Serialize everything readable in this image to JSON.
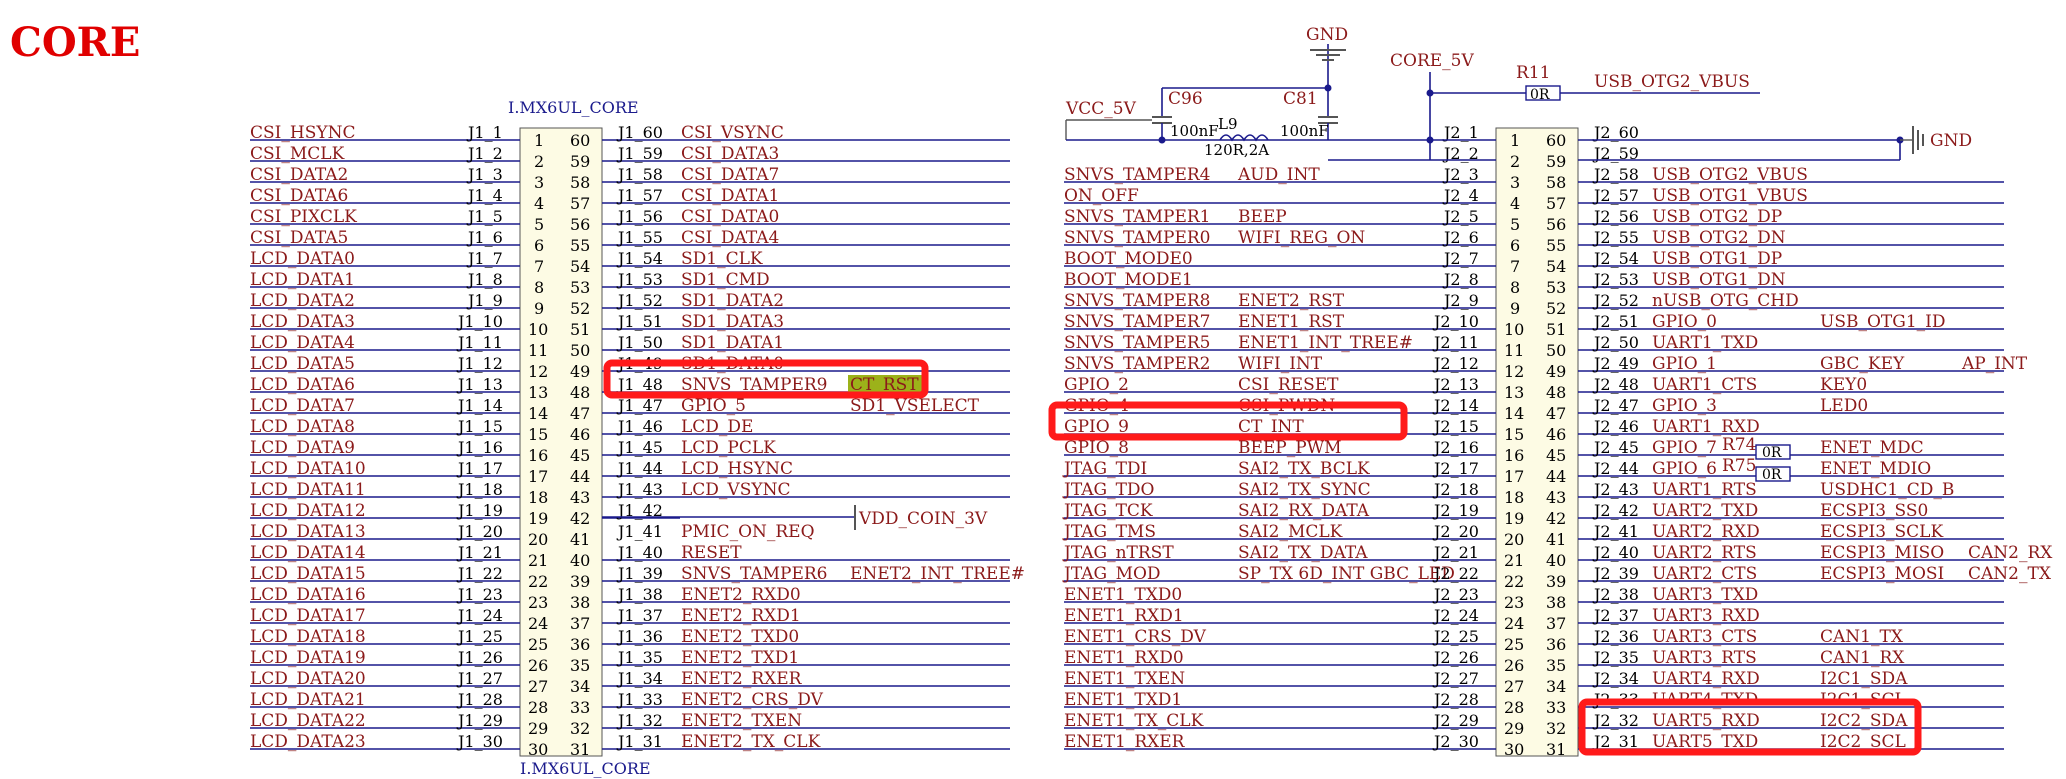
{
  "page_title": "CORE",
  "left_chip": {
    "name": "I.MX6UL_CORE",
    "left": [
      {
        "sig": "CSI_HSYNC",
        "ref": "J1_1"
      },
      {
        "sig": "CSI_MCLK",
        "ref": "J1_2"
      },
      {
        "sig": "CSI_DATA2",
        "ref": "J1_3"
      },
      {
        "sig": "CSI_DATA6",
        "ref": "J1_4"
      },
      {
        "sig": "CSI_PIXCLK",
        "ref": "J1_5"
      },
      {
        "sig": "CSI_DATA5",
        "ref": "J1_6"
      },
      {
        "sig": "LCD_DATA0",
        "ref": "J1_7"
      },
      {
        "sig": "LCD_DATA1",
        "ref": "J1_8"
      },
      {
        "sig": "LCD_DATA2",
        "ref": "J1_9"
      },
      {
        "sig": "LCD_DATA3",
        "ref": "J1_10"
      },
      {
        "sig": "LCD_DATA4",
        "ref": "J1_11"
      },
      {
        "sig": "LCD_DATA5",
        "ref": "J1_12"
      },
      {
        "sig": "LCD_DATA6",
        "ref": "J1_13"
      },
      {
        "sig": "LCD_DATA7",
        "ref": "J1_14"
      },
      {
        "sig": "LCD_DATA8",
        "ref": "J1_15"
      },
      {
        "sig": "LCD_DATA9",
        "ref": "J1_16"
      },
      {
        "sig": "LCD_DATA10",
        "ref": "J1_17"
      },
      {
        "sig": "LCD_DATA11",
        "ref": "J1_18"
      },
      {
        "sig": "LCD_DATA12",
        "ref": "J1_19"
      },
      {
        "sig": "LCD_DATA13",
        "ref": "J1_20"
      },
      {
        "sig": "LCD_DATA14",
        "ref": "J1_21"
      },
      {
        "sig": "LCD_DATA15",
        "ref": "J1_22"
      },
      {
        "sig": "LCD_DATA16",
        "ref": "J1_23"
      },
      {
        "sig": "LCD_DATA17",
        "ref": "J1_24"
      },
      {
        "sig": "LCD_DATA18",
        "ref": "J1_25"
      },
      {
        "sig": "LCD_DATA19",
        "ref": "J1_26"
      },
      {
        "sig": "LCD_DATA20",
        "ref": "J1_27"
      },
      {
        "sig": "LCD_DATA21",
        "ref": "J1_28"
      },
      {
        "sig": "LCD_DATA22",
        "ref": "J1_29"
      },
      {
        "sig": "LCD_DATA23",
        "ref": "J1_30"
      }
    ],
    "right": [
      {
        "ref": "J1_60",
        "sig": "CSI_VSYNC",
        "extra": ""
      },
      {
        "ref": "J1_59",
        "sig": "CSI_DATA3",
        "extra": ""
      },
      {
        "ref": "J1_58",
        "sig": "CSI_DATA7",
        "extra": ""
      },
      {
        "ref": "J1_57",
        "sig": "CSI_DATA1",
        "extra": ""
      },
      {
        "ref": "J1_56",
        "sig": "CSI_DATA0",
        "extra": ""
      },
      {
        "ref": "J1_55",
        "sig": "CSI_DATA4",
        "extra": ""
      },
      {
        "ref": "J1_54",
        "sig": "SD1_CLK",
        "extra": ""
      },
      {
        "ref": "J1_53",
        "sig": "SD1_CMD",
        "extra": ""
      },
      {
        "ref": "J1_52",
        "sig": "SD1_DATA2",
        "extra": ""
      },
      {
        "ref": "J1_51",
        "sig": "SD1_DATA3",
        "extra": ""
      },
      {
        "ref": "J1_50",
        "sig": "SD1_DATA1",
        "extra": ""
      },
      {
        "ref": "J1_49",
        "sig": "SD1_DATA0",
        "extra": ""
      },
      {
        "ref": "J1_48",
        "sig": "SNVS_TAMPER9",
        "extra": "CT_RST"
      },
      {
        "ref": "J1_47",
        "sig": "GPIO_5",
        "extra": "SD1_VSELECT"
      },
      {
        "ref": "J1_46",
        "sig": "LCD_DE",
        "extra": ""
      },
      {
        "ref": "J1_45",
        "sig": "LCD_PCLK",
        "extra": ""
      },
      {
        "ref": "J1_44",
        "sig": "LCD_HSYNC",
        "extra": ""
      },
      {
        "ref": "J1_43",
        "sig": "LCD_VSYNC",
        "extra": ""
      },
      {
        "ref": "J1_42",
        "sig": "",
        "extra": ""
      },
      {
        "ref": "J1_41",
        "sig": "PMIC_ON_REQ",
        "extra": ""
      },
      {
        "ref": "J1_40",
        "sig": "RESET",
        "extra": ""
      },
      {
        "ref": "J1_39",
        "sig": "SNVS_TAMPER6",
        "extra": "ENET2_INT_TREE#"
      },
      {
        "ref": "J1_38",
        "sig": "ENET2_RXD0",
        "extra": ""
      },
      {
        "ref": "J1_37",
        "sig": "ENET2_RXD1",
        "extra": ""
      },
      {
        "ref": "J1_36",
        "sig": "ENET2_TXD0",
        "extra": ""
      },
      {
        "ref": "J1_35",
        "sig": "ENET2_TXD1",
        "extra": ""
      },
      {
        "ref": "J1_34",
        "sig": "ENET2_RXER",
        "extra": ""
      },
      {
        "ref": "J1_33",
        "sig": "ENET2_CRS_DV",
        "extra": ""
      },
      {
        "ref": "J1_32",
        "sig": "ENET2_TXEN",
        "extra": ""
      },
      {
        "ref": "J1_31",
        "sig": "ENET2_TX_CLK",
        "extra": ""
      }
    ],
    "vdd_label": "VDD_COIN_3V"
  },
  "right_chip": {
    "left": [
      {
        "sig": "",
        "fn": "",
        "ref": "J2_1"
      },
      {
        "sig": "",
        "fn": "",
        "ref": "J2_2"
      },
      {
        "sig": "SNVS_TAMPER4",
        "fn": "AUD_INT",
        "ref": "J2_3"
      },
      {
        "sig": "ON_OFF",
        "fn": "",
        "ref": "J2_4"
      },
      {
        "sig": "SNVS_TAMPER1",
        "fn": "BEEP",
        "ref": "J2_5"
      },
      {
        "sig": "SNVS_TAMPER0",
        "fn": "WIFI_REG_ON",
        "ref": "J2_6"
      },
      {
        "sig": "BOOT_MODE0",
        "fn": "",
        "ref": "J2_7"
      },
      {
        "sig": "BOOT_MODE1",
        "fn": "",
        "ref": "J2_8"
      },
      {
        "sig": "SNVS_TAMPER8",
        "fn": "ENET2_RST",
        "ref": "J2_9"
      },
      {
        "sig": "SNVS_TAMPER7",
        "fn": "ENET1_RST",
        "ref": "J2_10"
      },
      {
        "sig": "SNVS_TAMPER5",
        "fn": "ENET1_INT_TREE#",
        "ref": "J2_11"
      },
      {
        "sig": "SNVS_TAMPER2",
        "fn": "WIFI_INT",
        "ref": "J2_12"
      },
      {
        "sig": "GPIO_2",
        "fn": "CSI_RESET",
        "ref": "J2_13"
      },
      {
        "sig": "GPIO_4",
        "fn": "CSI_PWDN",
        "ref": "J2_14"
      },
      {
        "sig": "GPIO_9",
        "fn": "CT_INT",
        "ref": "J2_15"
      },
      {
        "sig": "GPIO_8",
        "fn": "BEEP_PWM",
        "ref": "J2_16"
      },
      {
        "sig": "JTAG_TDI",
        "fn": "SAI2_TX_BCLK",
        "ref": "J2_17"
      },
      {
        "sig": "JTAG_TDO",
        "fn": "SAI2_TX_SYNC",
        "ref": "J2_18"
      },
      {
        "sig": "JTAG_TCK",
        "fn": "SAI2_RX_DATA",
        "ref": "J2_19"
      },
      {
        "sig": "JTAG_TMS",
        "fn": "SAI2_MCLK",
        "ref": "J2_20"
      },
      {
        "sig": "JTAG_nTRST",
        "fn": "SAI2_TX_DATA",
        "ref": "J2_21"
      },
      {
        "sig": "JTAG_MOD",
        "fn": "SP_TX   6D_INT   GBC_LED",
        "ref": "J2_22"
      },
      {
        "sig": "ENET1_TXD0",
        "fn": "",
        "ref": "J2_23"
      },
      {
        "sig": "ENET1_RXD1",
        "fn": "",
        "ref": "J2_24"
      },
      {
        "sig": "ENET1_CRS_DV",
        "fn": "",
        "ref": "J2_25"
      },
      {
        "sig": "ENET1_RXD0",
        "fn": "",
        "ref": "J2_26"
      },
      {
        "sig": "ENET1_TXEN",
        "fn": "",
        "ref": "J2_27"
      },
      {
        "sig": "ENET1_TXD1",
        "fn": "",
        "ref": "J2_28"
      },
      {
        "sig": "ENET1_TX_CLK",
        "fn": "",
        "ref": "J2_29"
      },
      {
        "sig": "ENET1_RXER",
        "fn": "",
        "ref": "J2_30"
      }
    ],
    "right": [
      {
        "ref": "J2_60",
        "sig": "",
        "fn": "",
        "fn2": ""
      },
      {
        "ref": "J2_59",
        "sig": "",
        "fn": "",
        "fn2": ""
      },
      {
        "ref": "J2_58",
        "sig": "USB_OTG2_VBUS",
        "fn": "",
        "fn2": ""
      },
      {
        "ref": "J2_57",
        "sig": "USB_OTG1_VBUS",
        "fn": "",
        "fn2": ""
      },
      {
        "ref": "J2_56",
        "sig": "USB_OTG2_DP",
        "fn": "",
        "fn2": ""
      },
      {
        "ref": "J2_55",
        "sig": "USB_OTG2_DN",
        "fn": "",
        "fn2": ""
      },
      {
        "ref": "J2_54",
        "sig": "USB_OTG1_DP",
        "fn": "",
        "fn2": ""
      },
      {
        "ref": "J2_53",
        "sig": "USB_OTG1_DN",
        "fn": "",
        "fn2": ""
      },
      {
        "ref": "J2_52",
        "sig": "nUSB_OTG_CHD",
        "fn": "",
        "fn2": ""
      },
      {
        "ref": "J2_51",
        "sig": "GPIO_0",
        "fn": "USB_OTG1_ID",
        "fn2": ""
      },
      {
        "ref": "J2_50",
        "sig": "UART1_TXD",
        "fn": "",
        "fn2": ""
      },
      {
        "ref": "J2_49",
        "sig": "GPIO_1",
        "fn": "GBC_KEY",
        "fn2": "AP_INT"
      },
      {
        "ref": "J2_48",
        "sig": "UART1_CTS",
        "fn": "KEY0",
        "fn2": ""
      },
      {
        "ref": "J2_47",
        "sig": "GPIO_3",
        "fn": "LED0",
        "fn2": ""
      },
      {
        "ref": "J2_46",
        "sig": "UART1_RXD",
        "fn": "",
        "fn2": ""
      },
      {
        "ref": "J2_45",
        "sig": "GPIO_7",
        "fn": "ENET_MDC",
        "fn2": ""
      },
      {
        "ref": "J2_44",
        "sig": "GPIO_6",
        "fn": "ENET_MDIO",
        "fn2": ""
      },
      {
        "ref": "J2_43",
        "sig": "UART1_RTS",
        "fn": "USDHC1_CD_B",
        "fn2": ""
      },
      {
        "ref": "J2_42",
        "sig": "UART2_TXD",
        "fn": "ECSPI3_SS0",
        "fn2": ""
      },
      {
        "ref": "J2_41",
        "sig": "UART2_RXD",
        "fn": "ECSPI3_SCLK",
        "fn2": ""
      },
      {
        "ref": "J2_40",
        "sig": "UART2_RTS",
        "fn": "ECSPI3_MISO",
        "fn2": "CAN2_RX"
      },
      {
        "ref": "J2_39",
        "sig": "UART2_CTS",
        "fn": "ECSPI3_MOSI",
        "fn2": "CAN2_TX"
      },
      {
        "ref": "J2_38",
        "sig": "UART3_TXD",
        "fn": "",
        "fn2": ""
      },
      {
        "ref": "J2_37",
        "sig": "UART3_RXD",
        "fn": "",
        "fn2": ""
      },
      {
        "ref": "J2_36",
        "sig": "UART3_CTS",
        "fn": "CAN1_TX",
        "fn2": ""
      },
      {
        "ref": "J2_35",
        "sig": "UART3_RTS",
        "fn": "CAN1_RX",
        "fn2": ""
      },
      {
        "ref": "J2_34",
        "sig": "UART4_RXD",
        "fn": "I2C1_SDA",
        "fn2": ""
      },
      {
        "ref": "J2_33",
        "sig": "UART4_TXD",
        "fn": "I2C1_SCL",
        "fn2": ""
      },
      {
        "ref": "J2_32",
        "sig": "UART5_RXD",
        "fn": "I2C2_SDA",
        "fn2": ""
      },
      {
        "ref": "J2_31",
        "sig": "UART5_TXD",
        "fn": "I2C2_SCL",
        "fn2": ""
      }
    ]
  },
  "power": {
    "gnd_top": "GND",
    "gnd_right": "GND",
    "core_5v": "CORE_5V",
    "vcc_5v": "VCC_5V",
    "usb_vbus": "USB_OTG2_VBUS",
    "c96": "C96",
    "c81": "C81",
    "c96_val": "100nF",
    "c81_val": "100nF",
    "l9": "L9",
    "l9_val": "120R,2A",
    "r11": "R11",
    "r11_val": "0R",
    "r74": "R74",
    "r75": "R75",
    "r74_val": "0R",
    "r75_val": "0R"
  },
  "colors": {
    "net_label": "#8b1a1a",
    "wire": "#1a1a8c",
    "chip_fill": "#fdfbe4",
    "highlight": "#ff1a1a",
    "ct_rst_fill": "#9cb21a"
  }
}
